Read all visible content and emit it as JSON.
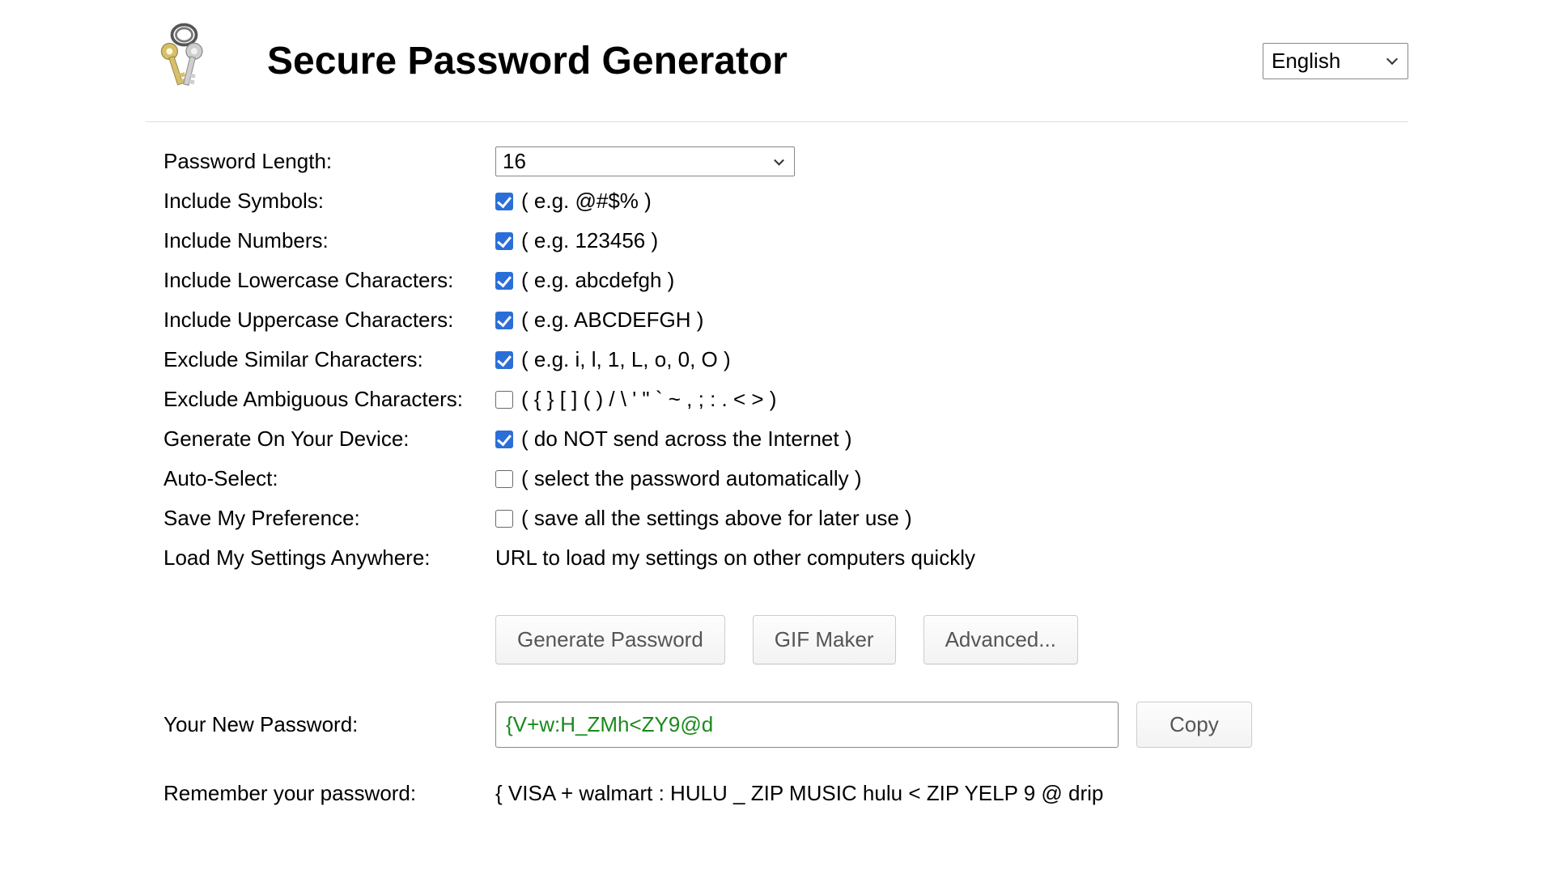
{
  "header": {
    "title": "Secure Password Generator",
    "language": "English"
  },
  "form": {
    "password_length": {
      "label": "Password Length:",
      "value": "16"
    },
    "include_symbols": {
      "label": "Include Symbols:",
      "checked": true,
      "hint": "( e.g. @#$% )"
    },
    "include_numbers": {
      "label": "Include Numbers:",
      "checked": true,
      "hint": "( e.g. 123456 )"
    },
    "include_lowercase": {
      "label": "Include Lowercase Characters:",
      "checked": true,
      "hint": "( e.g. abcdefgh )"
    },
    "include_uppercase": {
      "label": "Include Uppercase Characters:",
      "checked": true,
      "hint": "( e.g. ABCDEFGH )"
    },
    "exclude_similar": {
      "label": "Exclude Similar Characters:",
      "checked": true,
      "hint": "( e.g. i, l, 1, L, o, 0, O )"
    },
    "exclude_ambiguous": {
      "label": "Exclude Ambiguous Characters:",
      "checked": false,
      "hint": "( { } [ ] ( ) / \\ ' \" ` ~ , ; : . < > )"
    },
    "generate_on_device": {
      "label": "Generate On Your Device:",
      "checked": true,
      "hint": "( do NOT send across the Internet )"
    },
    "auto_select": {
      "label": "Auto-Select:",
      "checked": false,
      "hint": "( select the password automatically )"
    },
    "save_pref": {
      "label": "Save My Preference:",
      "checked": false,
      "hint": "( save all the settings above for later use )"
    },
    "load_settings": {
      "label": "Load My Settings Anywhere:",
      "link_text": "URL to load my settings on other computers quickly"
    }
  },
  "buttons": {
    "generate": "Generate Password",
    "gif": "GIF Maker",
    "advanced": "Advanced...",
    "copy": "Copy"
  },
  "output": {
    "label": "Your New Password:",
    "value": "{V+w:H_ZMh<ZY9@d"
  },
  "remember": {
    "label": "Remember your password:",
    "text": "{ VISA + walmart : HULU _ ZIP MUSIC hulu < ZIP YELP 9 @ drip"
  }
}
